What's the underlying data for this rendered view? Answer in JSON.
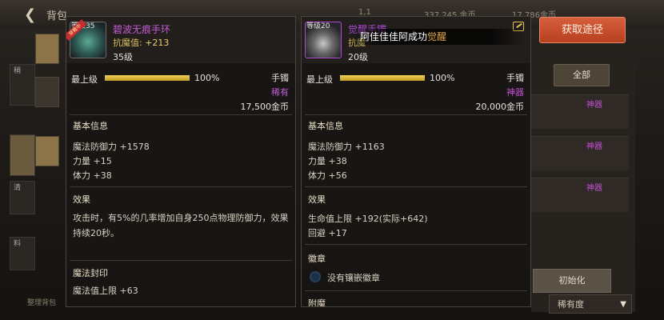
{
  "header": {
    "back_glyph": "❮",
    "title": "背包",
    "info1": "1,1",
    "info2": "337,245 金币",
    "info3": "17,786金币"
  },
  "notice": {
    "text": "阿佳佳佳阿成功",
    "highlight": "觉醒"
  },
  "left_item": {
    "level_tag": "等级35",
    "ribbon": "穿戴中",
    "name": "碧波无痕手环",
    "resist_label": "抗魔值:",
    "resist_value": "+213",
    "level": "35级",
    "max_level_label": "最上级",
    "progress_pct": 100,
    "progress_text": "100%",
    "slot": "手镯",
    "rarity": "稀有",
    "rarity_color": "#c35bd6",
    "price": "17,500金币",
    "basic_title": "基本信息",
    "stats": [
      "魔法防御力 +1578",
      "力量 +15",
      "体力 +38"
    ],
    "effect_title": "效果",
    "effect_text": "攻击时，有5%的几率增加自身250点物理防御力，效果持续20秒。",
    "seal_title": "魔法封印",
    "seal_stat": "魔法值上限 +63"
  },
  "right_item": {
    "level_tag": "等级20",
    "name": "觉醒手镯",
    "resist_label": "抗魔",
    "level": "20级",
    "max_level_label": "最上级",
    "progress_pct": 100,
    "progress_text": "100%",
    "slot": "手镯",
    "rarity": "神器",
    "rarity_color": "#c44fd2",
    "price": "20,000金币",
    "basic_title": "基本信息",
    "stats": [
      "魔法防御力 +1163",
      "力量 +38",
      "体力 +56"
    ],
    "effect_title": "效果",
    "effect_stats": [
      "生命值上限 +192(实际+642)",
      "回避 +17"
    ],
    "badge_title": "徽章",
    "badge_empty": "没有镶嵌徽章",
    "enchant_title": "附魔"
  },
  "side_panel": {
    "get_button": "获取途径",
    "all_button": "全部",
    "rarity_labels": [
      "神器",
      "神器",
      "神器"
    ],
    "init_button": "初始化",
    "sort_label": "稀有度",
    "sort_arrow": "▼",
    "close_glyph": "✕",
    "footer_text": "整理背包"
  },
  "left_tabs": [
    "稍",
    "清",
    "料"
  ],
  "colors": {
    "accent_orange": "#d85f3c",
    "gold_bar": "#e0bd3e",
    "epic_purple": "#c35bd6"
  }
}
